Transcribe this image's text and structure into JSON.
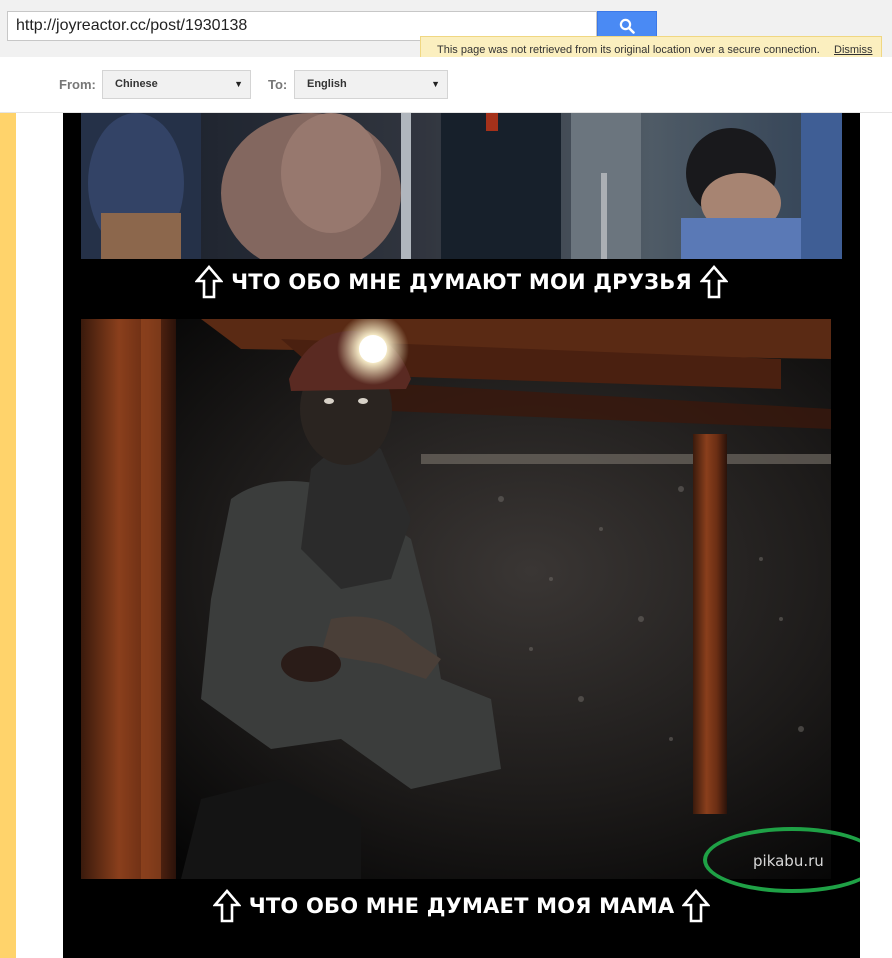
{
  "address_bar": {
    "url": "http://joyreactor.cc/post/1930138",
    "search_icon": "magnifier-icon"
  },
  "notice": {
    "text": "This page was not retrieved from its original location over a secure connection.",
    "dismiss_label": "Dismiss"
  },
  "translate_bar": {
    "from_label": "From:",
    "from_value": "Chinese",
    "to_label": "To:",
    "to_value": "English",
    "caret": "▼"
  },
  "meme": {
    "caption_top": "ЧТО ОБО МНЕ ДУМАЮТ МОИ ДРУЗЬЯ",
    "caption_bottom": "ЧТО ОБО МНЕ ДУМАЕТ МОЯ МАМА",
    "watermark": "pikabu.ru",
    "arrow_icon": "up-arrow-icon",
    "colors": {
      "circle": "#1fa146",
      "caption": "#ffffff",
      "background": "#000000"
    }
  },
  "colors": {
    "search_button": "#4a8af4",
    "notice_bg": "#fbefbf",
    "left_strip": "#ffd36b"
  }
}
